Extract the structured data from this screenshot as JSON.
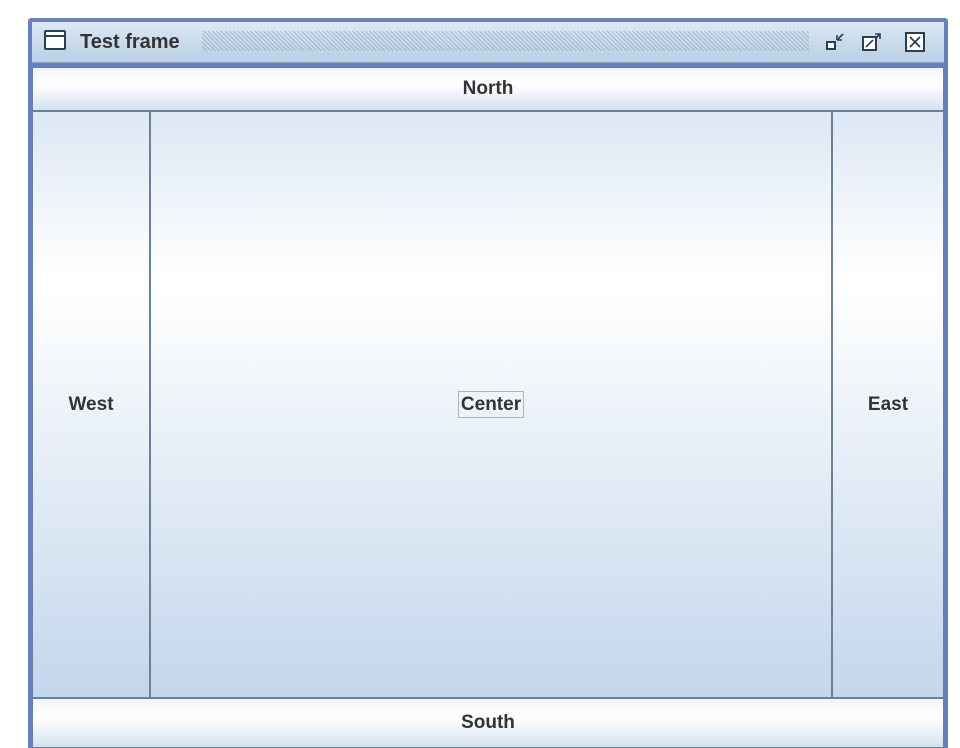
{
  "window": {
    "title": "Test frame",
    "icon": "frame-icon",
    "controls": {
      "minimize_icon": "iconify-icon",
      "maximize_icon": "maximize-icon",
      "close_icon": "close-icon"
    }
  },
  "layout": {
    "north": "North",
    "west": "West",
    "center": "Center",
    "east": "East",
    "south": "South"
  },
  "colors": {
    "border": "#6382bf",
    "text": "#333333",
    "gradient_top": "#dce7f4",
    "gradient_bottom": "#c3d6ec"
  }
}
